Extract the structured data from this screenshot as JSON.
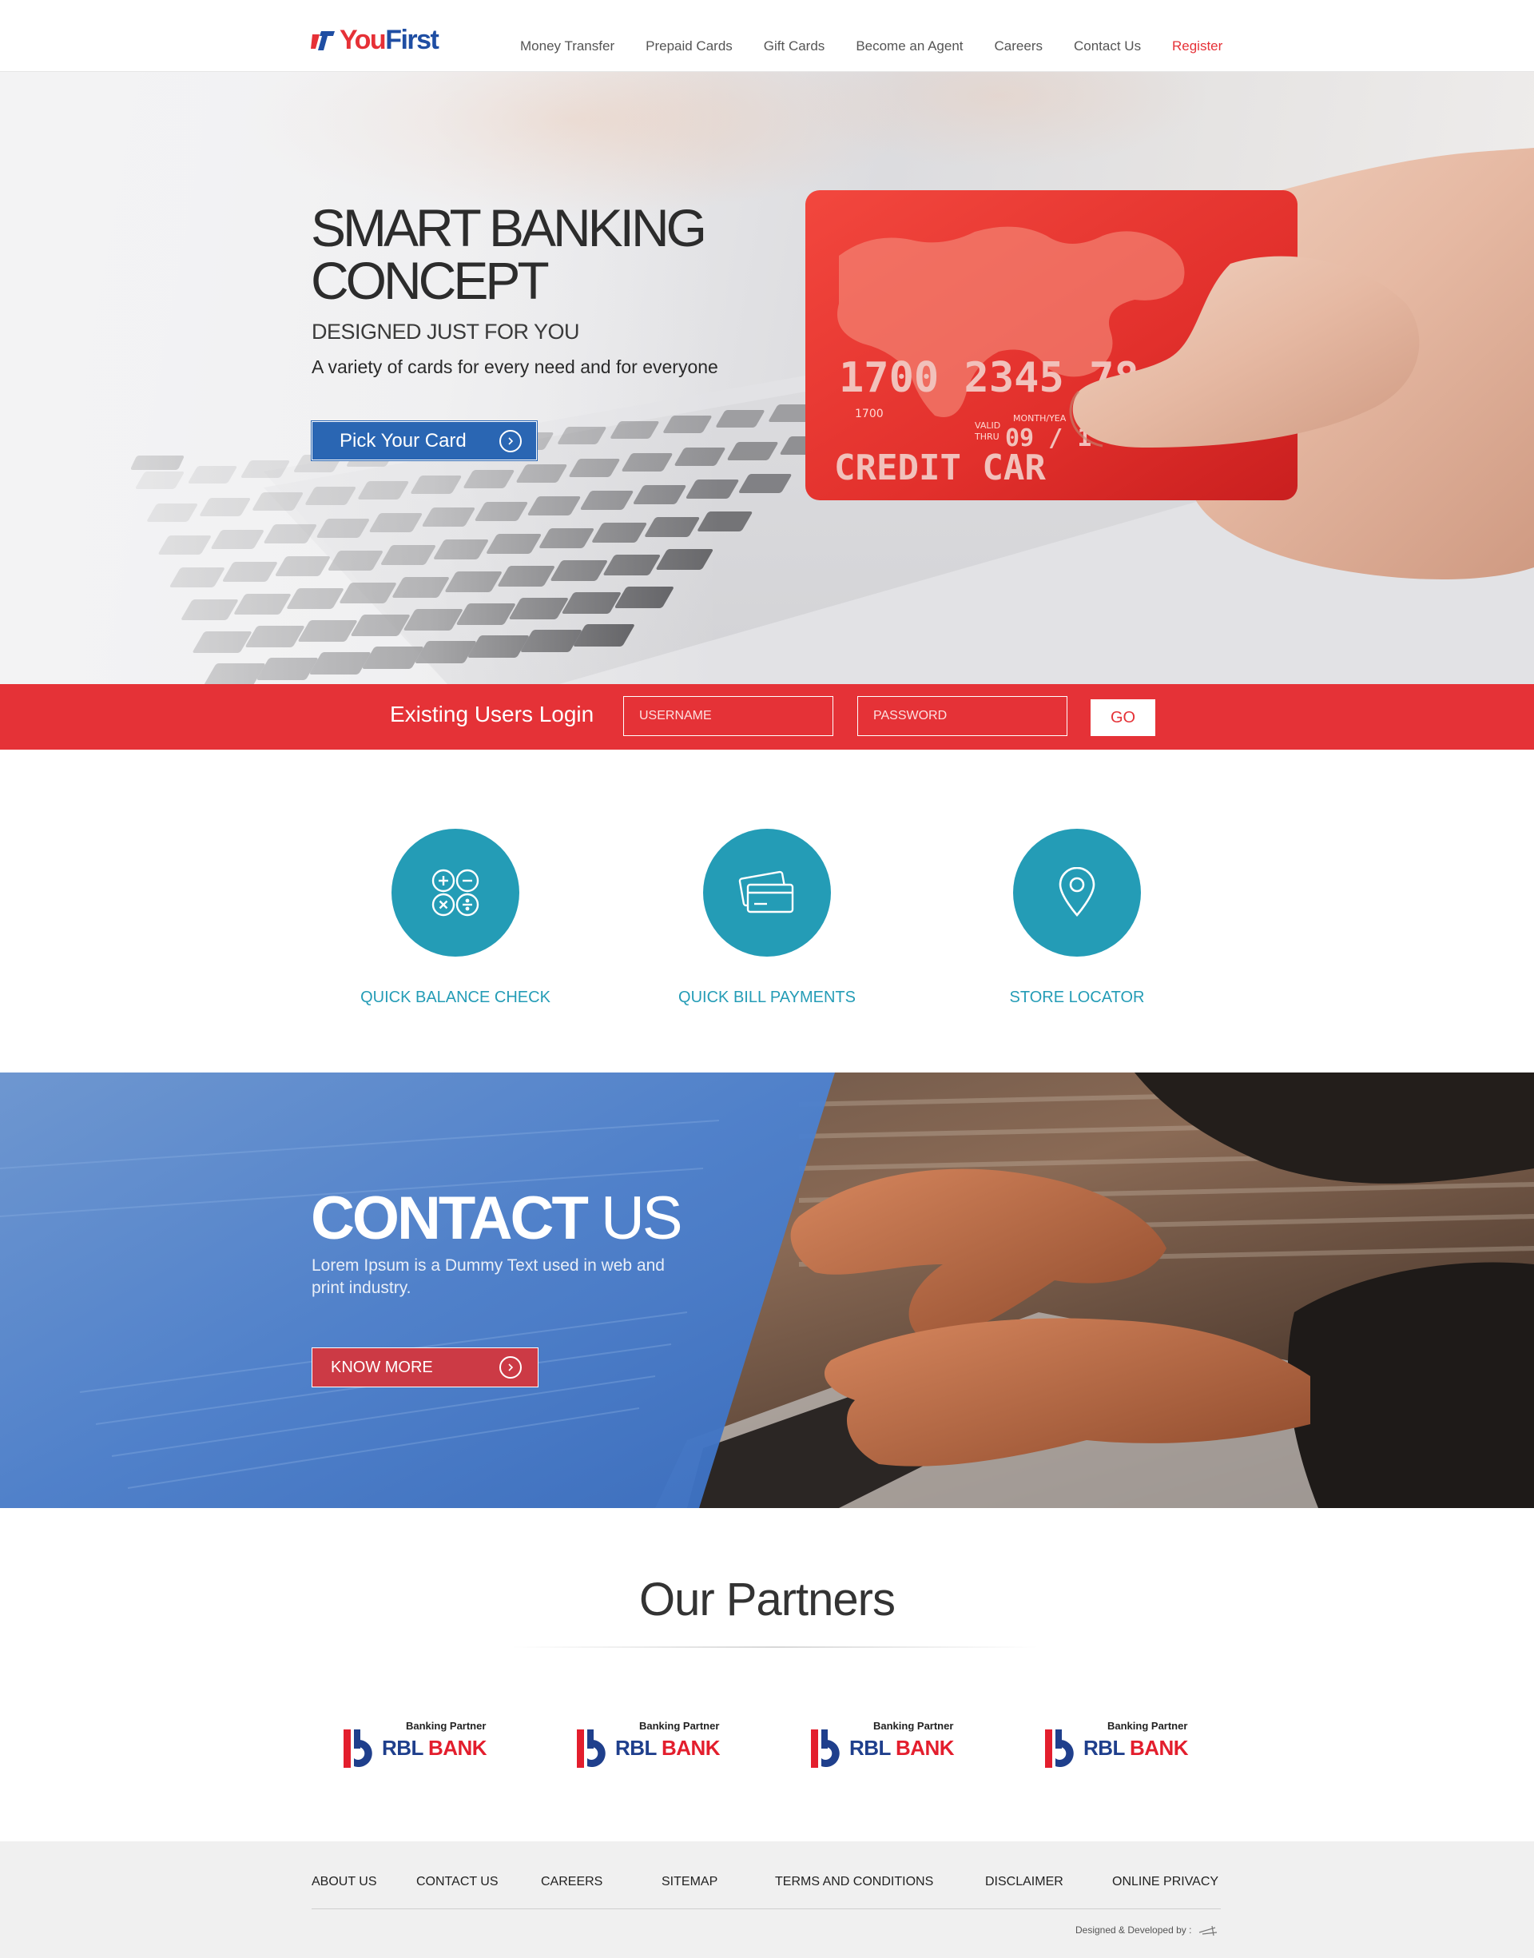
{
  "header": {
    "logo_you": "You",
    "logo_first": "First",
    "nav": [
      "Money Transfer",
      "Prepaid Cards",
      "Gift Cards",
      "Become an Agent",
      "Careers",
      "Contact Us"
    ],
    "register": "Register"
  },
  "hero": {
    "title_line1": "SMART BANKING",
    "title_line2": "CONCEPT",
    "subtitle": "DESIGNED JUST FOR YOU",
    "description": "A variety of cards for  every need and for everyone",
    "button": "Pick Your Card",
    "card_number": "1700 2345 78",
    "card_small_number": "1700",
    "card_valid": "VALID",
    "card_thru": "THRU",
    "card_month_year": "MONTH/YEA",
    "card_expiry": "09 / 1",
    "card_label": "CREDIT CAR"
  },
  "login": {
    "title": "Existing Users Login",
    "username_placeholder": "USERNAME",
    "password_placeholder": "PASSWORD",
    "go": "GO"
  },
  "features": [
    {
      "label": "QUICK BALANCE CHECK",
      "icon": "calculator-icon"
    },
    {
      "label": "QUICK BILL PAYMENTS",
      "icon": "cards-icon"
    },
    {
      "label": "STORE LOCATOR",
      "icon": "map-pin-icon"
    }
  ],
  "contact": {
    "title_bold": "CONTACT",
    "title_light": "US",
    "description": "Lorem Ipsum is a Dummy Text used in web and print industry.",
    "button": "KNOW MORE"
  },
  "partners": {
    "title": "Our Partners",
    "items": [
      {
        "caption": "Banking Partner",
        "name_a": "RBL",
        "name_b": "BANK"
      },
      {
        "caption": "Banking Partner",
        "name_a": "RBL",
        "name_b": "BANK"
      },
      {
        "caption": "Banking Partner",
        "name_a": "RBL",
        "name_b": "BANK"
      },
      {
        "caption": "Banking Partner",
        "name_a": "RBL",
        "name_b": "BANK"
      }
    ]
  },
  "footer": {
    "links": [
      "ABOUT US",
      "CONTACT US",
      "CAREERS",
      "SITEMAP",
      "TERMS AND CONDITIONS",
      "DISCLAIMER",
      "ONLINE PRIVACY"
    ],
    "credit": "Designed & Developed by :"
  },
  "colors": {
    "brand_red": "#e53237",
    "brand_blue": "#2a66b3",
    "teal": "#249cb6"
  }
}
